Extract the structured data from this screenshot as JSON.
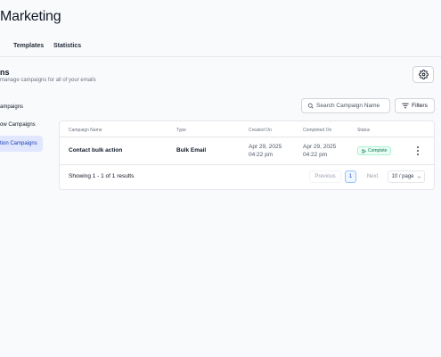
{
  "app": {
    "title": "Marketing"
  },
  "tabs": [
    {
      "label": "Templates"
    },
    {
      "label": "Statistics"
    }
  ],
  "section": {
    "title": "ns",
    "subtitle": "manage campaigns for all of your emails"
  },
  "sidebar": {
    "items": [
      {
        "label": "ampaigns"
      },
      {
        "label": "ow Campaigns"
      },
      {
        "label": "tion Campaigns",
        "active": true
      }
    ]
  },
  "search": {
    "placeholder": "Search Campaign Name"
  },
  "filters": {
    "label": "Filters"
  },
  "table": {
    "columns": [
      "Campaign Name",
      "Type",
      "Created On",
      "Completed On",
      "Status"
    ],
    "rows": [
      {
        "name": "Contact bulk action",
        "type": "Bulk Email",
        "created_date": "Apr 29, 2025",
        "created_time": "04:22 pm",
        "completed_date": "Apr 29, 2025",
        "completed_time": "04:22 pm",
        "status": "Complete"
      }
    ]
  },
  "pagination": {
    "summary": "Showing 1 - 1 of 1 results",
    "previous": "Previous",
    "current_page": "1",
    "next": "Next",
    "page_size": "10 / page"
  },
  "colors": {
    "accent": "#1d4ed8",
    "active_bg": "#e0e7ff",
    "status_complete": "#047857"
  },
  "icons": [
    "settings-gear-icon",
    "search-icon",
    "filter-icon",
    "play-icon",
    "kebab-menu-icon",
    "chevron-down-icon"
  ]
}
